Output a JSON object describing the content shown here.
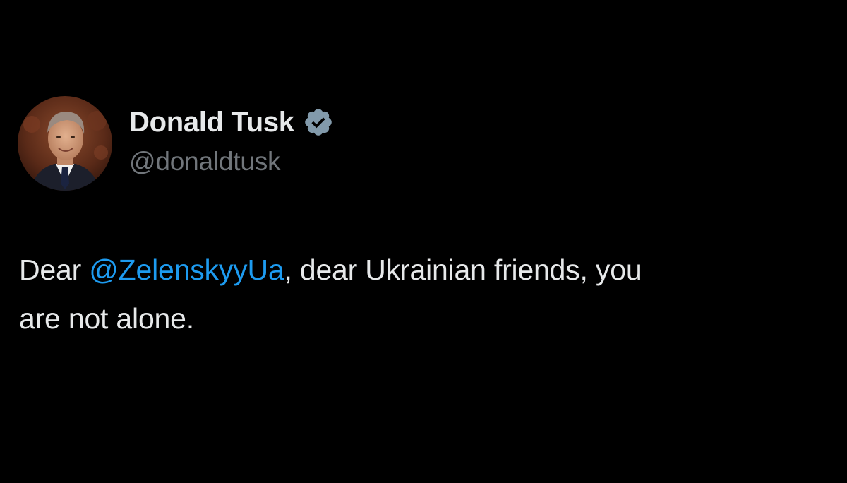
{
  "author": {
    "display_name": "Donald Tusk",
    "handle": "@donaldtusk",
    "verified": true,
    "verified_icon": "verified-badge-icon",
    "avatar": "profile-photo"
  },
  "tweet": {
    "text_before_mention": "Dear ",
    "mention": "@ZelenskyyUa",
    "text_line1_after_mention": ", dear Ukrainian friends, you",
    "text_line2": "are not alone."
  },
  "colors": {
    "background": "#000000",
    "primary_text": "#e7e9ea",
    "secondary_text": "#71767b",
    "link": "#1d9bf0",
    "verified_badge": "#829aab"
  }
}
